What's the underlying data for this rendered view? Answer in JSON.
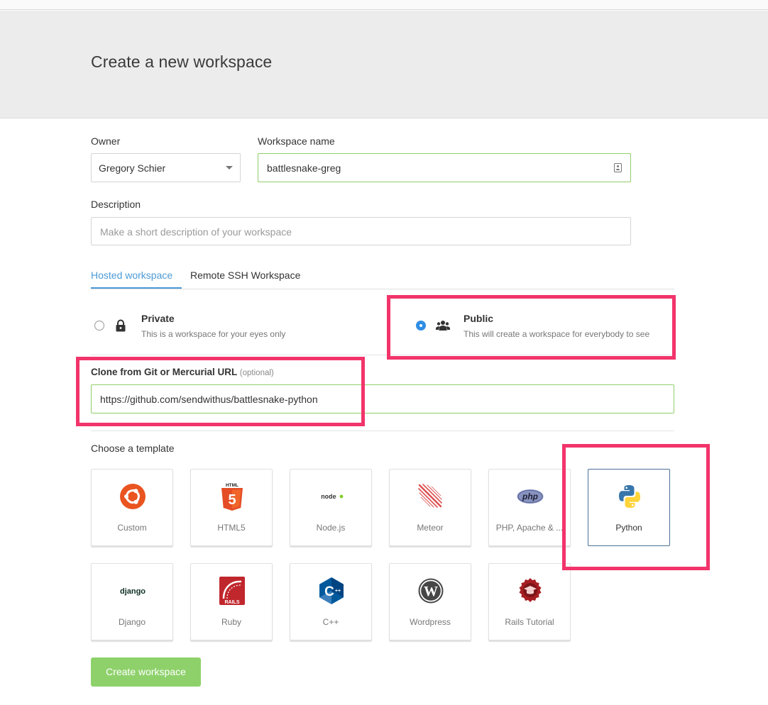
{
  "page": {
    "title": "Create a new workspace"
  },
  "form": {
    "owner_label": "Owner",
    "owner_value": "Gregory Schier",
    "workspace_name_label": "Workspace name",
    "workspace_name_value": "battlesnake-greg",
    "description_label": "Description",
    "description_placeholder": "Make a short description of your workspace",
    "clone_label": "Clone from Git or Mercurial URL",
    "clone_optional": "(optional)",
    "clone_value": "https://github.com/sendwithus/battlesnake-python",
    "template_label": "Choose a template",
    "submit_label": "Create workspace"
  },
  "tabs": [
    {
      "label": "Hosted workspace",
      "active": true
    },
    {
      "label": "Remote SSH Workspace",
      "active": false
    }
  ],
  "visibility": {
    "selected": "public",
    "private": {
      "title": "Private",
      "description": "This is a workspace for your eyes only",
      "icon": "lock-icon"
    },
    "public": {
      "title": "Public",
      "description": "This will create a workspace for everybody to see",
      "icon": "group-icon"
    }
  },
  "templates": [
    {
      "name": "Custom",
      "icon": "ubuntu-icon",
      "selected": false
    },
    {
      "name": "HTML5",
      "icon": "html5-icon",
      "selected": false
    },
    {
      "name": "Node.js",
      "icon": "nodejs-icon",
      "selected": false
    },
    {
      "name": "Meteor",
      "icon": "meteor-icon",
      "selected": false
    },
    {
      "name": "PHP, Apache & ...",
      "icon": "php-icon",
      "selected": false
    },
    {
      "name": "Python",
      "icon": "python-icon",
      "selected": true
    },
    {
      "name": "Django",
      "icon": "django-icon",
      "selected": false
    },
    {
      "name": "Ruby",
      "icon": "rails-icon",
      "selected": false
    },
    {
      "name": "C++",
      "icon": "cpp-icon",
      "selected": false
    },
    {
      "name": "Wordpress",
      "icon": "wordpress-icon",
      "selected": false
    },
    {
      "name": "Rails Tutorial",
      "icon": "rails-tutorial-icon",
      "selected": false
    }
  ],
  "logo_text": {
    "html5": "HTML",
    "html5_digit": "5",
    "nodejs": "node",
    "php": "php",
    "django": "django",
    "rails": "RAILS",
    "cpp": "C",
    "cpp_plus": "++",
    "wordpress": "W"
  },
  "colors": {
    "accent_blue": "#4b9ad6",
    "radio_blue": "#2f8de4",
    "valid_green": "#8fce6b",
    "button_green": "#8ed16b",
    "highlight_pink": "#f2346b",
    "selected_card_border": "#4a6f96"
  }
}
